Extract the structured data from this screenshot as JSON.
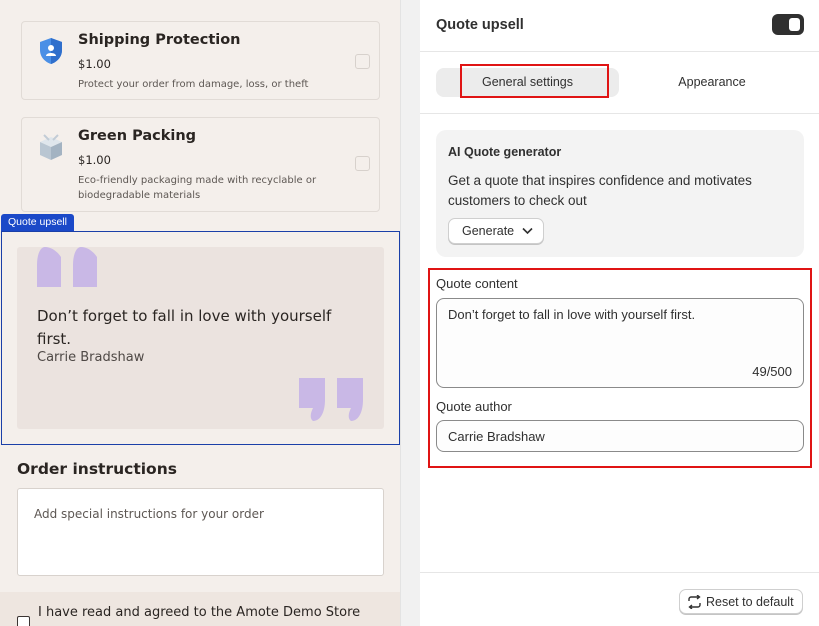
{
  "preview": {
    "products": [
      {
        "title": "Shipping Protection",
        "price": "$1.00",
        "description": "Protect your order from damage, loss, or theft",
        "icon": "shield-icon"
      },
      {
        "title": "Green Packing",
        "price": "$1.00",
        "description": "Eco-friendly packaging made with recyclable or biodegradable materials",
        "icon": "package-icon"
      }
    ],
    "quote_block": {
      "tag": "Quote upsell",
      "text": "Don’t forget to fall in love with yourself first.",
      "author": "Carrie Bradshaw"
    },
    "order_instructions": {
      "title": "Order instructions",
      "placeholder": "Add special instructions for your order"
    },
    "agreement": {
      "text": "I have read and agreed to the Amote Demo Store"
    }
  },
  "panel": {
    "title": "Quote upsell",
    "toggle_on": true,
    "tabs": [
      {
        "label": "General settings",
        "active": true
      },
      {
        "label": "Appearance",
        "active": false
      }
    ],
    "ai_card": {
      "title": "AI Quote generator",
      "description": "Get a quote that inspires confidence and motivates customers to check out",
      "button": "Generate"
    },
    "quote_content": {
      "label": "Quote content",
      "value": "Don’t forget to fall in love with yourself first.",
      "counter": "49/500"
    },
    "quote_author": {
      "label": "Quote author",
      "value": "Carrie Bradshaw"
    },
    "footer": {
      "reset_button": "Reset to default"
    }
  },
  "colors": {
    "highlight": "#e01414",
    "selection": "#1b49c8",
    "quote_mark": "#c9b8e6",
    "preview_bg": "#f4efeb"
  }
}
